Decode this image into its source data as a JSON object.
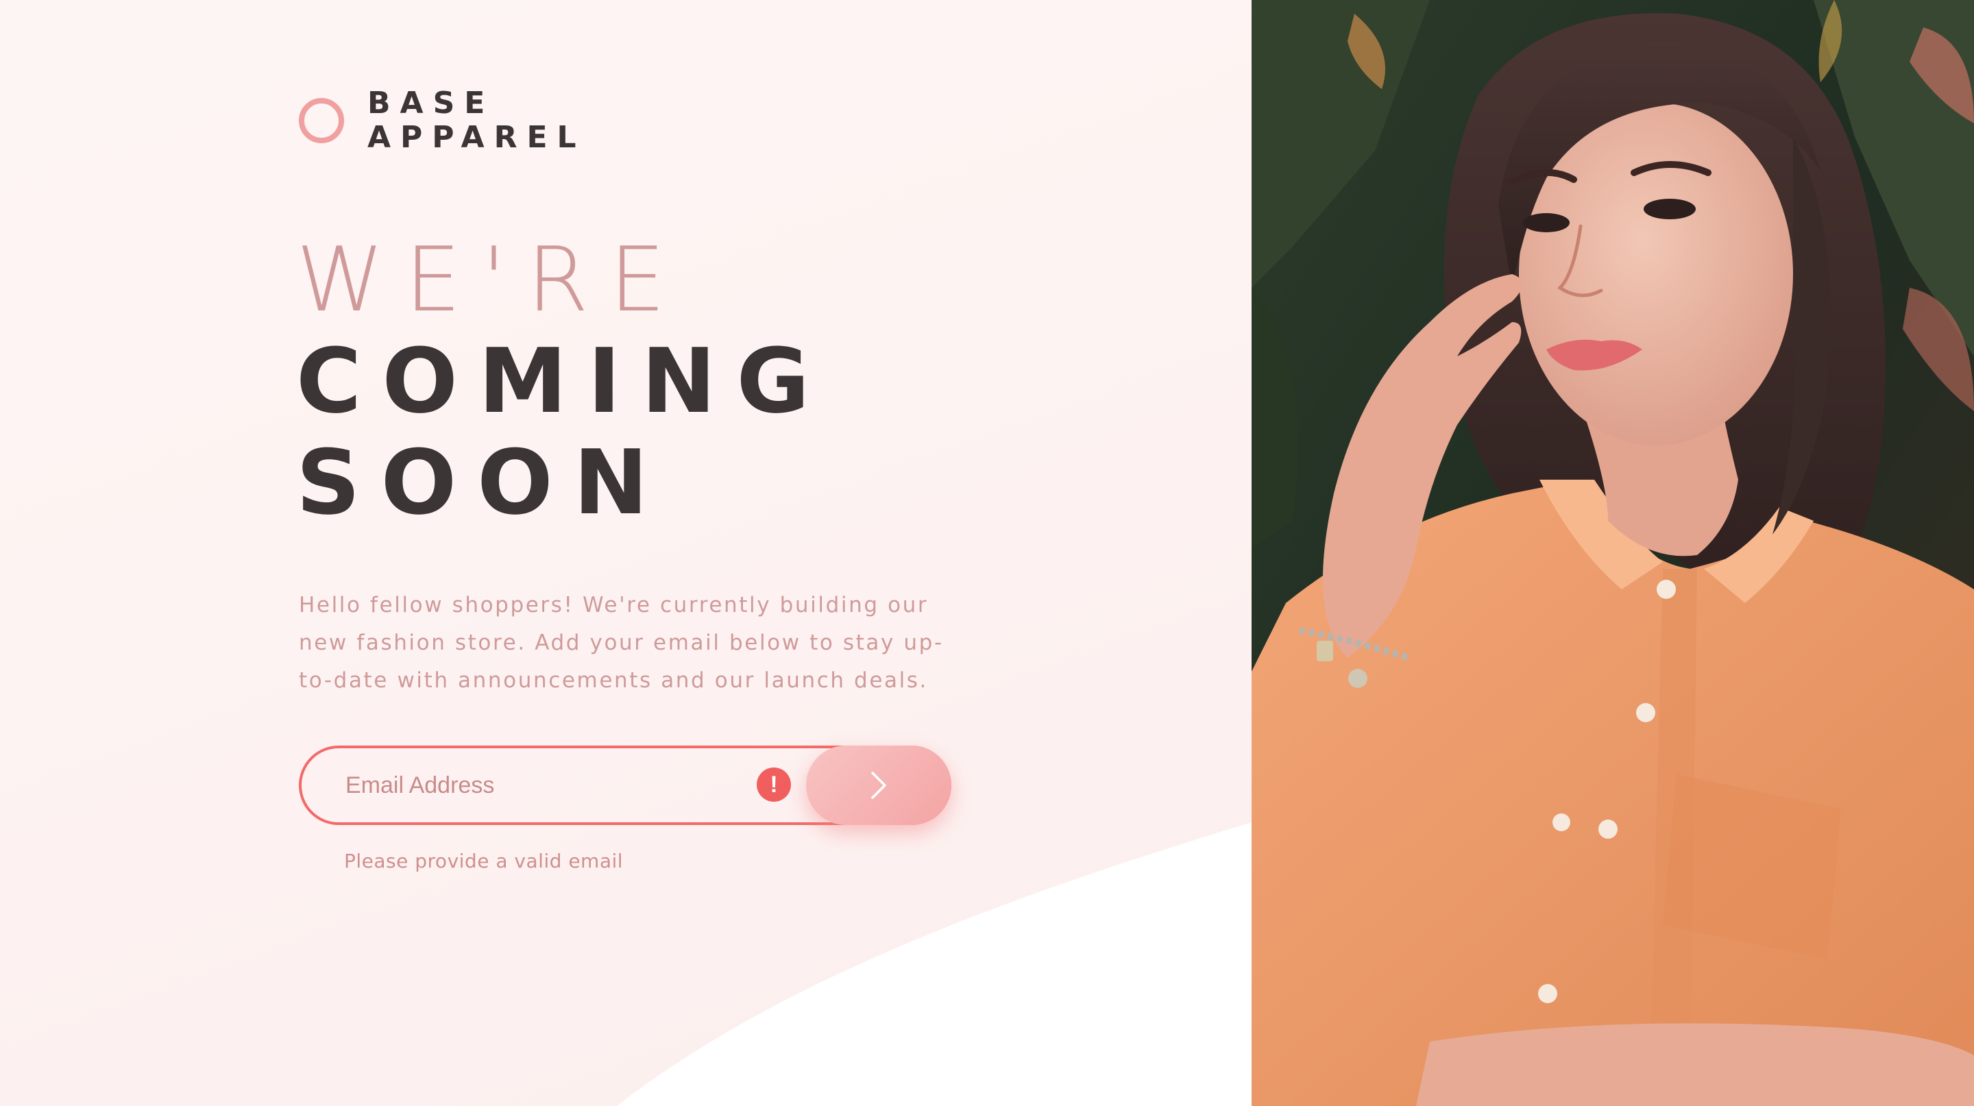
{
  "brand": {
    "line1": "BASE",
    "line2": "APPAREL",
    "logo_icon": "ring-icon"
  },
  "headline": {
    "line1": "WE'RE",
    "line2": "COMING",
    "line3": "SOON"
  },
  "description": "Hello fellow shoppers! We're currently building our new fashion store. Add your email below to stay up-to-date with announcements and our launch deals.",
  "form": {
    "email_placeholder": "Email Address",
    "email_value": "",
    "error_icon": "exclamation-icon",
    "error_icon_glyph": "!",
    "submit_icon": "chevron-right-icon",
    "error_message": "Please provide a valid email"
  },
  "hero": {
    "image_icon": "hero-photo-woman-orange-shirt"
  },
  "colors": {
    "accent": "#f26a6a",
    "accent_soft": "#f4a4a4",
    "heading_dark": "#3b3536",
    "text_pink": "#cf9a9a",
    "background": "#fdf4f3"
  }
}
